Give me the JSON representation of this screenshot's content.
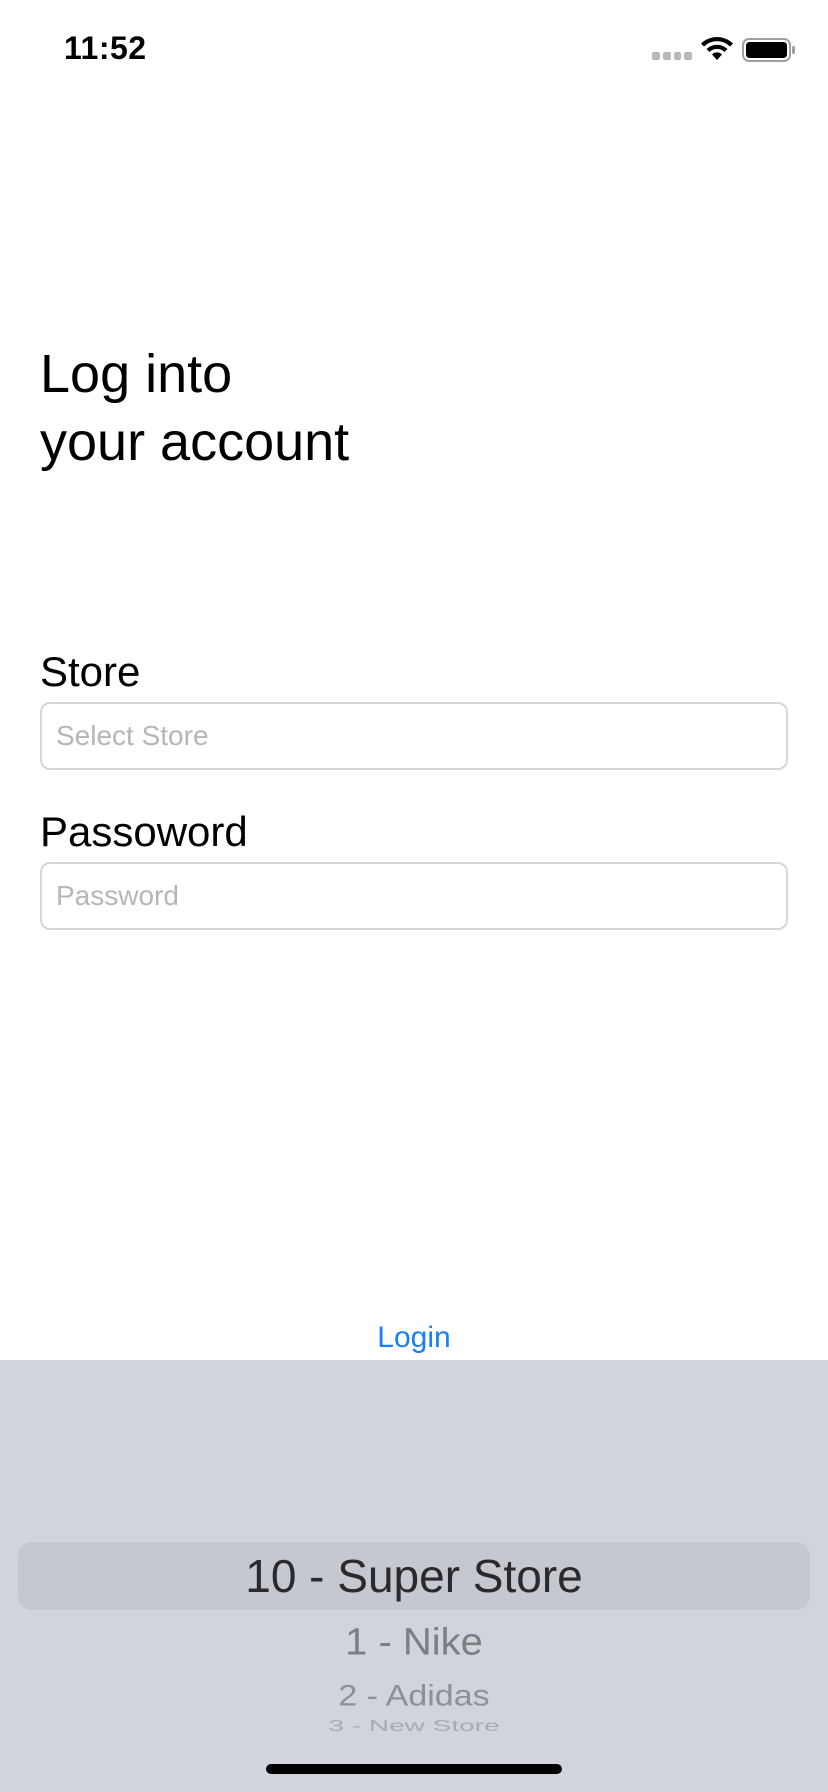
{
  "status_bar": {
    "time": "11:52",
    "icons": [
      "cellular-signal-icon",
      "wifi-icon",
      "battery-icon"
    ]
  },
  "title": "Log into\nyour account",
  "form": {
    "store": {
      "label": "Store",
      "placeholder": "Select Store",
      "value": ""
    },
    "password": {
      "label": "Passoword",
      "placeholder": "Password",
      "value": ""
    },
    "login_label": "Login"
  },
  "picker": {
    "selected": "10 - Super Store",
    "options": [
      "1 - Nike",
      "2 - Adidas",
      "3 - New Store"
    ]
  },
  "colors": {
    "accent": "#1a7ef5",
    "picker_background": "#d1d4da",
    "picker_highlight": "#c6c8cf",
    "field_border": "#d6d6d6",
    "placeholder": "#b6b6ba"
  }
}
